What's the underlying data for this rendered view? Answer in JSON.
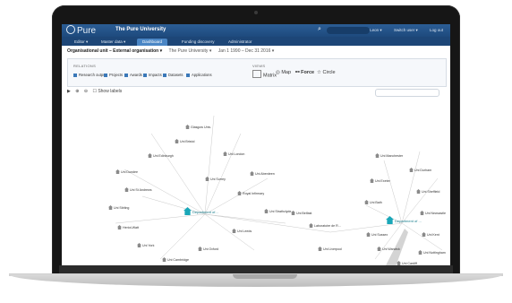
{
  "app": {
    "logo": "Pure",
    "university": "The Pure University",
    "user_links": [
      "Leon ▾",
      "Switch user ▾",
      "Log out"
    ]
  },
  "tabs": [
    "Editor ▾",
    "Master data ▾",
    "Dashboard",
    "Funding discovery",
    "Administrator"
  ],
  "breadcrumb": {
    "unit": "Organisational unit – External organisation ▾",
    "org": "The Pure University ▾",
    "period": "Jan 1 1990 – Dec 31 2016 ▾"
  },
  "relations": {
    "label": "RELATIONS",
    "items": [
      "Research output",
      "Projects",
      "Awards",
      "Impacts",
      "Datasets",
      "Applications"
    ]
  },
  "views": {
    "label": "VIEWS",
    "items": [
      "Matrix",
      "Map",
      "Force",
      "Circle"
    ],
    "active": "Force"
  },
  "tools": {
    "play": "▶",
    "zoom_in": "⊕",
    "zoom_out": "⊖",
    "show_labels": "Show labels"
  },
  "graph": {
    "hub_left": "Department of...",
    "hub_right": "Department of ...",
    "nodes": [
      "Glasgow Univ.",
      "Uni Edinburgh",
      "Uni London",
      "Uni Dundee",
      "Uni Aberdeen",
      "Uni St Andrews",
      "Royal Infirmary",
      "Uni Stirling",
      "Uni Strathclyde",
      "Heriot-Watt",
      "Uni Leeds",
      "Uni York",
      "Uni Oxford",
      "Uni Cambridge",
      "Uni Bristol",
      "Uni Manchester",
      "Uni Durham",
      "Uni Exeter",
      "Uni Sheffield",
      "Uni Bath",
      "Laboratoire de R...",
      "Uni Newcastle",
      "Uni Sussex",
      "Uni Kent",
      "Uni Warwick",
      "Uni Nottingham",
      "Uni Liverpool",
      "Uni Cardiff",
      "Uni Belfast",
      "Uni Surrey"
    ]
  }
}
